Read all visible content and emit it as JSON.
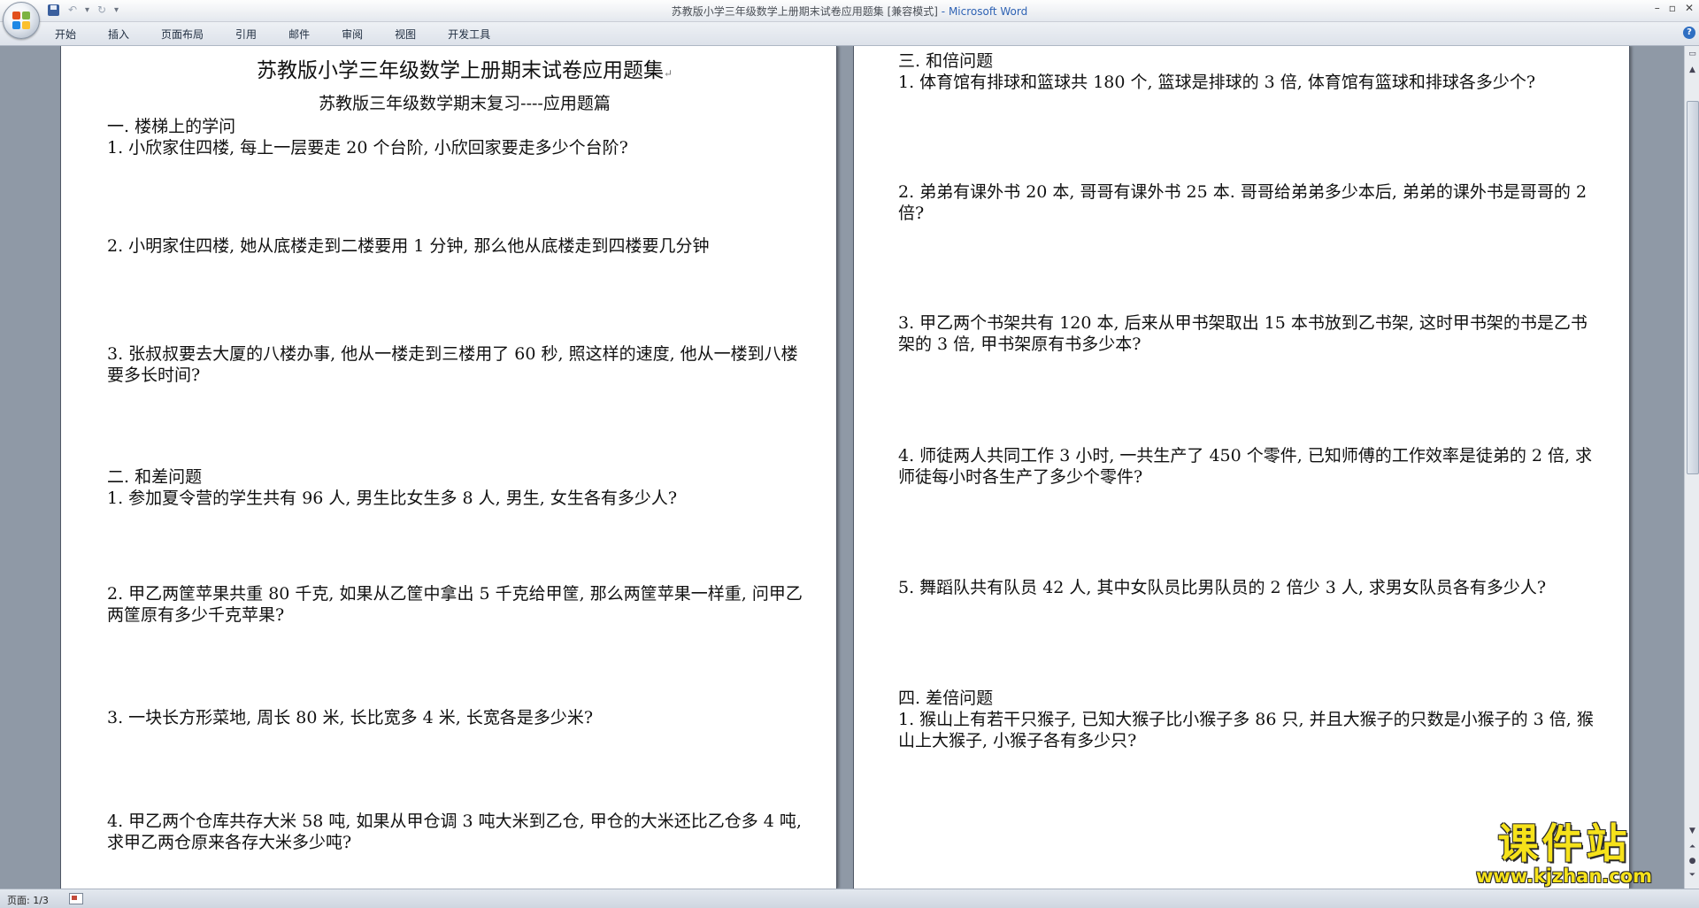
{
  "window": {
    "title": "苏教版小学三年级数学上册期末试卷应用题集 [兼容模式]",
    "app_name": "- Microsoft Word",
    "controls": [
      "–",
      "▫",
      "✕"
    ]
  },
  "ribbon": {
    "tabs": [
      "开始",
      "插入",
      "页面布局",
      "引用",
      "邮件",
      "审阅",
      "视图",
      "开发工具"
    ]
  },
  "document": {
    "title": "苏教版小学三年级数学上册期末试卷应用题集",
    "subtitle": "苏教版三年级数学期末复习----应用题篇",
    "left_page": {
      "section1": {
        "heading": "一. 楼梯上的学问",
        "q1": "1. 小欣家住四楼, 每上一层要走 20 个台阶, 小欣回家要走多少个台阶?",
        "q2": "2. 小明家住四楼, 她从底楼走到二楼要用  1  分钟, 那么他从底楼走到四楼要几分钟",
        "q3": "3. 张叔叔要去大厦的八楼办事, 他从一楼走到三楼用了 60 秒, 照这样的速度, 他从一楼到八楼要多长时间?"
      },
      "section2": {
        "heading": "二. 和差问题",
        "q1": "1. 参加夏令营的学生共有 96 人, 男生比女生多 8 人, 男生, 女生各有多少人?",
        "q2": "2. 甲乙两筐苹果共重 80 千克, 如果从乙筐中拿出 5 千克给甲筐, 那么两筐苹果一样重, 问甲乙两筐原有多少千克苹果?",
        "q3": "3. 一块长方形菜地, 周长 80 米, 长比宽多 4 米, 长宽各是多少米?",
        "q4": "4. 甲乙两个仓库共存大米 58 吨, 如果从甲仓调 3 吨大米到乙仓, 甲仓的大米还比乙仓多 4 吨, 求甲乙两仓原来各存大米多少吨?"
      }
    },
    "right_page": {
      "section3": {
        "heading": "三. 和倍问题",
        "q1": "1. 体育馆有排球和篮球共 180 个, 篮球是排球的 3 倍, 体育馆有篮球和排球各多少个?",
        "q2": "2. 弟弟有课外书 20 本, 哥哥有课外书 25 本. 哥哥给弟弟多少本后, 弟弟的课外书是哥哥的 2 倍?",
        "q3": "3. 甲乙两个书架共有 120 本, 后来从甲书架取出 15 本书放到乙书架, 这时甲书架的书是乙书架的 3 倍, 甲书架原有书多少本?",
        "q4": "4. 师徒两人共同工作 3 小时, 一共生产了 450 个零件, 已知师傅的工作效率是徒弟的 2 倍, 求师徒每小时各生产了多少个零件?",
        "q5": "5. 舞蹈队共有队员 42 人, 其中女队员比男队员的 2 倍少 3 人, 求男女队员各有多少人?"
      },
      "section4": {
        "heading": "四. 差倍问题",
        "q1": "1. 猴山上有若干只猴子, 已知大猴子比小猴子多 86 只, 并且大猴子的只数是小猴子的 3 倍, 猴山上大猴子, 小猴子各有多少只?"
      }
    }
  },
  "statusbar": {
    "page_info": "页面: 1/3"
  },
  "watermark": {
    "brand": "课件站",
    "url": "www.kjzhan.com"
  }
}
